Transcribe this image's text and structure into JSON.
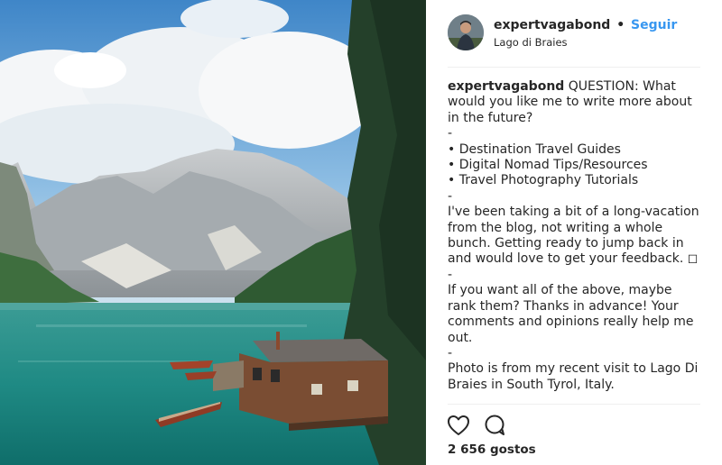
{
  "post": {
    "username": "expertvagabond",
    "separator": "•",
    "follow_label": "Seguir",
    "location": "Lago di Braies",
    "image_alt": "Lago di Braies lake with boathouse and rowing boats",
    "caption": {
      "username": "expertvagabond",
      "lines": [
        "QUESTION: What would you like me to write more about in the future?",
        "-",
        "• Destination Travel Guides",
        "• Digital Nomad Tips/Resources",
        "• Travel Photography Tutorials",
        "-",
        "I've been taking a bit of a long-vacation from the blog, not writing a whole bunch. Getting ready to jump back in and would love to get your feedback. ◻",
        "-",
        "If you want all of the above, maybe rank them? Thanks in advance! Your comments and opinions really help me out.",
        "-",
        "Photo is from my recent visit to Lago Di Braies in South Tyrol, Italy."
      ]
    },
    "likes": "2 656 gostos",
    "icons": {
      "like": "heart-icon",
      "comment": "speech-bubble-icon"
    },
    "colors": {
      "follow": "#3897f0",
      "text": "#262626",
      "divider": "#efefef"
    }
  }
}
